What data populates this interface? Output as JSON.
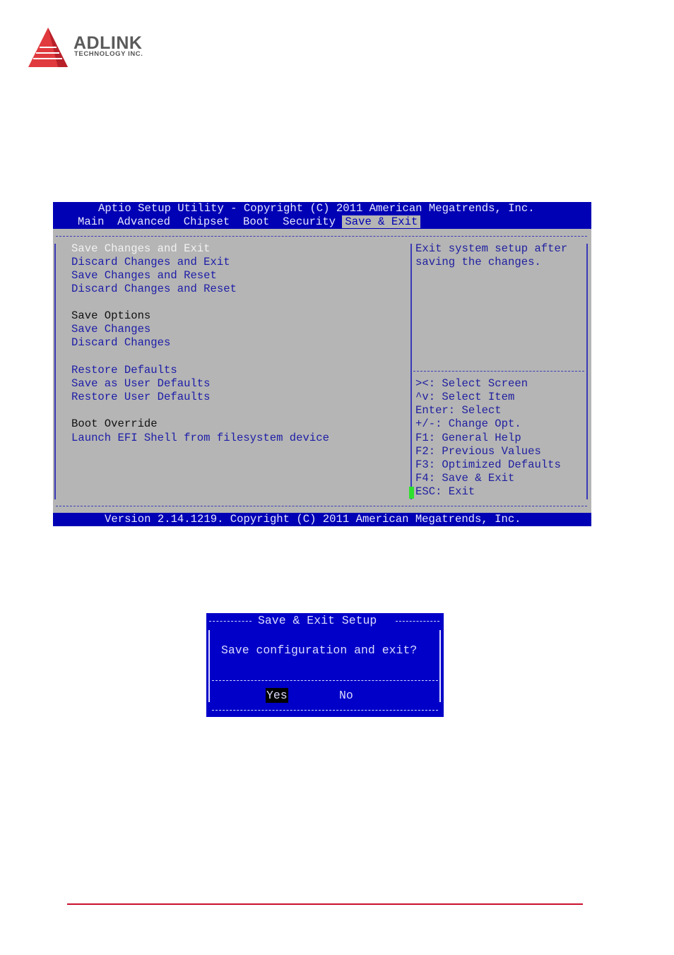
{
  "logo": {
    "brand": "ADLINK",
    "tagline": "TECHNOLOGY INC.",
    "color": "#e03a3e"
  },
  "bios": {
    "title": "Aptio Setup Utility - Copyright (C) 2011 American Megatrends, Inc.",
    "tabs": [
      "Main",
      "Advanced",
      "Chipset",
      "Boot",
      "Security",
      "Save & Exit"
    ],
    "active_tab": "Save & Exit",
    "menu": [
      {
        "label": "Save Changes and Exit",
        "selected": true
      },
      {
        "label": "Discard Changes and Exit"
      },
      {
        "label": "Save Changes and Reset"
      },
      {
        "label": "Discard Changes and Reset"
      },
      {
        "label": "Save Options",
        "header": true
      },
      {
        "label": "Save Changes"
      },
      {
        "label": "Discard Changes"
      },
      {
        "label": "Restore Defaults"
      },
      {
        "label": "Save as User Defaults"
      },
      {
        "label": "Restore User Defaults"
      },
      {
        "label": "Boot Override",
        "header": true
      },
      {
        "label": "Launch EFI Shell from filesystem device"
      }
    ],
    "help": [
      "Exit system setup after",
      "saving the changes."
    ],
    "keys": [
      "><: Select Screen",
      "^v: Select Item",
      "Enter: Select",
      "+/-: Change Opt.",
      "F1: General Help",
      "F2: Previous Values",
      "F3: Optimized Defaults",
      "F4: Save & Exit",
      "ESC: Exit"
    ],
    "version": "Version 2.14.1219. Copyright (C) 2011 American Megatrends, Inc.",
    "colors": {
      "bar": "#0000b4",
      "panel": "#b5b5b5",
      "item": "#1c1ca8"
    }
  },
  "dialog": {
    "title": "Save & Exit Setup",
    "message": "Save configuration and exit?",
    "yes": "Yes",
    "no": "No",
    "selected": "Yes",
    "color": "#0000c8"
  }
}
